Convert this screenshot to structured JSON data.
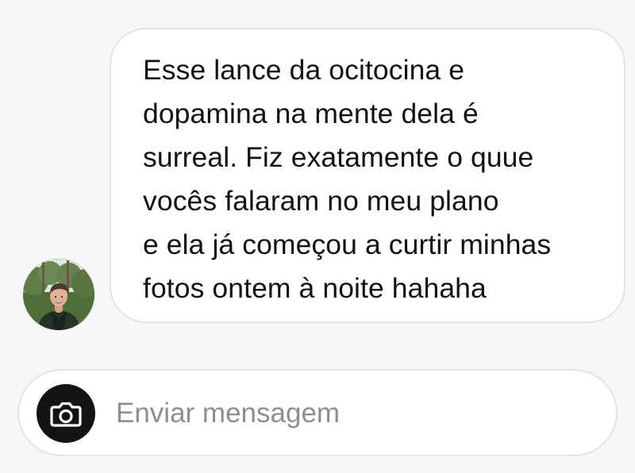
{
  "conversation": {
    "message": {
      "lines": [
        "Esse lance da ocitocina e",
        "dopamina na mente dela é",
        "surreal. Fiz exatamente o quue",
        "vocês falaram no meu plano",
        "e ela já começou a curtir minhas",
        "fotos ontem à noite hahaha"
      ]
    },
    "sender_avatar_icon": "user-avatar-photo"
  },
  "composer": {
    "camera_icon": "camera-icon",
    "placeholder": "Enviar mensagem",
    "value": ""
  },
  "colors": {
    "background": "#f7f7f7",
    "bubble_background": "#ffffff",
    "bubble_border": "#e3e3e3",
    "text": "#111111",
    "placeholder": "#8e8e8e",
    "camera_button": "#141414"
  }
}
